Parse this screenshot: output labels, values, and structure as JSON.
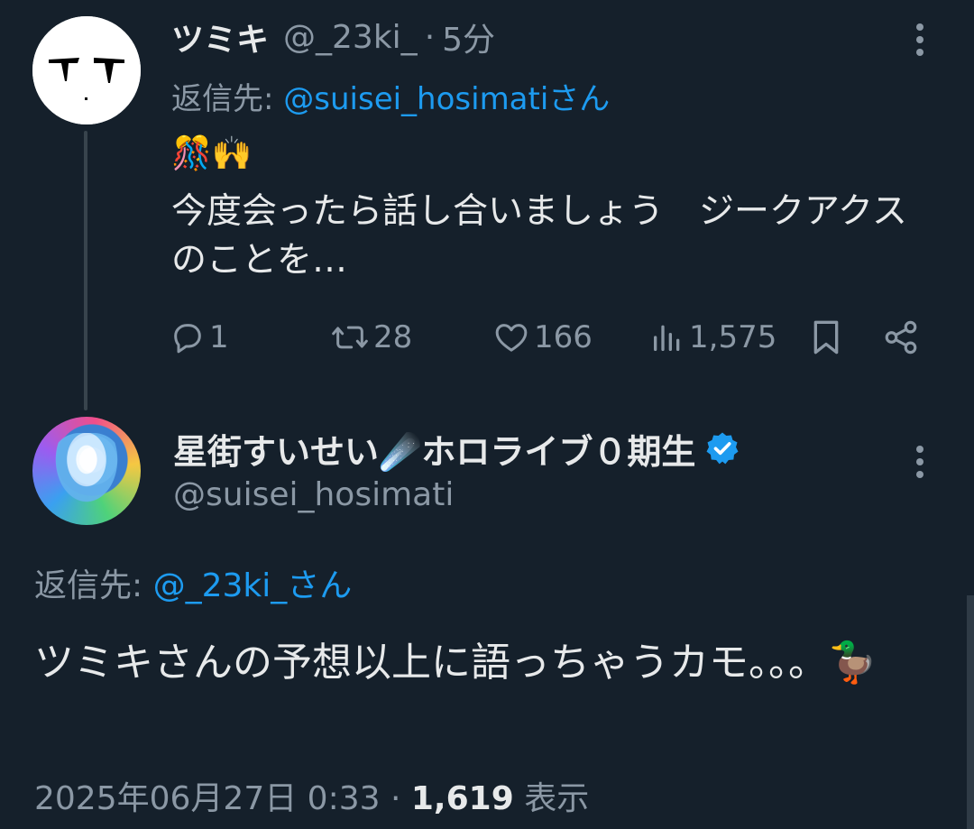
{
  "reply_tweet": {
    "display_name": "ツミキ",
    "handle": "@_23ki_",
    "time_ago": "5分",
    "reply_prefix": "返信先: ",
    "reply_to": "@suisei_hosimatiさん",
    "emoji_line": "🎊🙌",
    "text": "今度会ったら話し合いましょう　ジークアクスのことを…",
    "stats": {
      "replies": "1",
      "reposts": "28",
      "likes": "166",
      "views": "1,575"
    }
  },
  "main_tweet": {
    "display_name": "星街すいせい☄️ホロライブ０期生",
    "handle": "@suisei_hosimati",
    "reply_prefix": "返信先: ",
    "reply_to": "@_23ki_さん",
    "text": "ツミキさんの予想以上に語っちゃうカモ。。。🦆",
    "timestamp": "2025年06月27日 0:33",
    "view_count": "1,619",
    "view_label": "表示"
  },
  "colors": {
    "background": "#15202b",
    "text": "#e7e9ea",
    "muted": "#8b98a5",
    "accent": "#1d9bf0"
  },
  "icons": [
    "more-vertical-icon",
    "reply-icon",
    "repost-icon",
    "like-icon",
    "views-icon",
    "bookmark-icon",
    "share-icon",
    "verified-badge-icon"
  ]
}
